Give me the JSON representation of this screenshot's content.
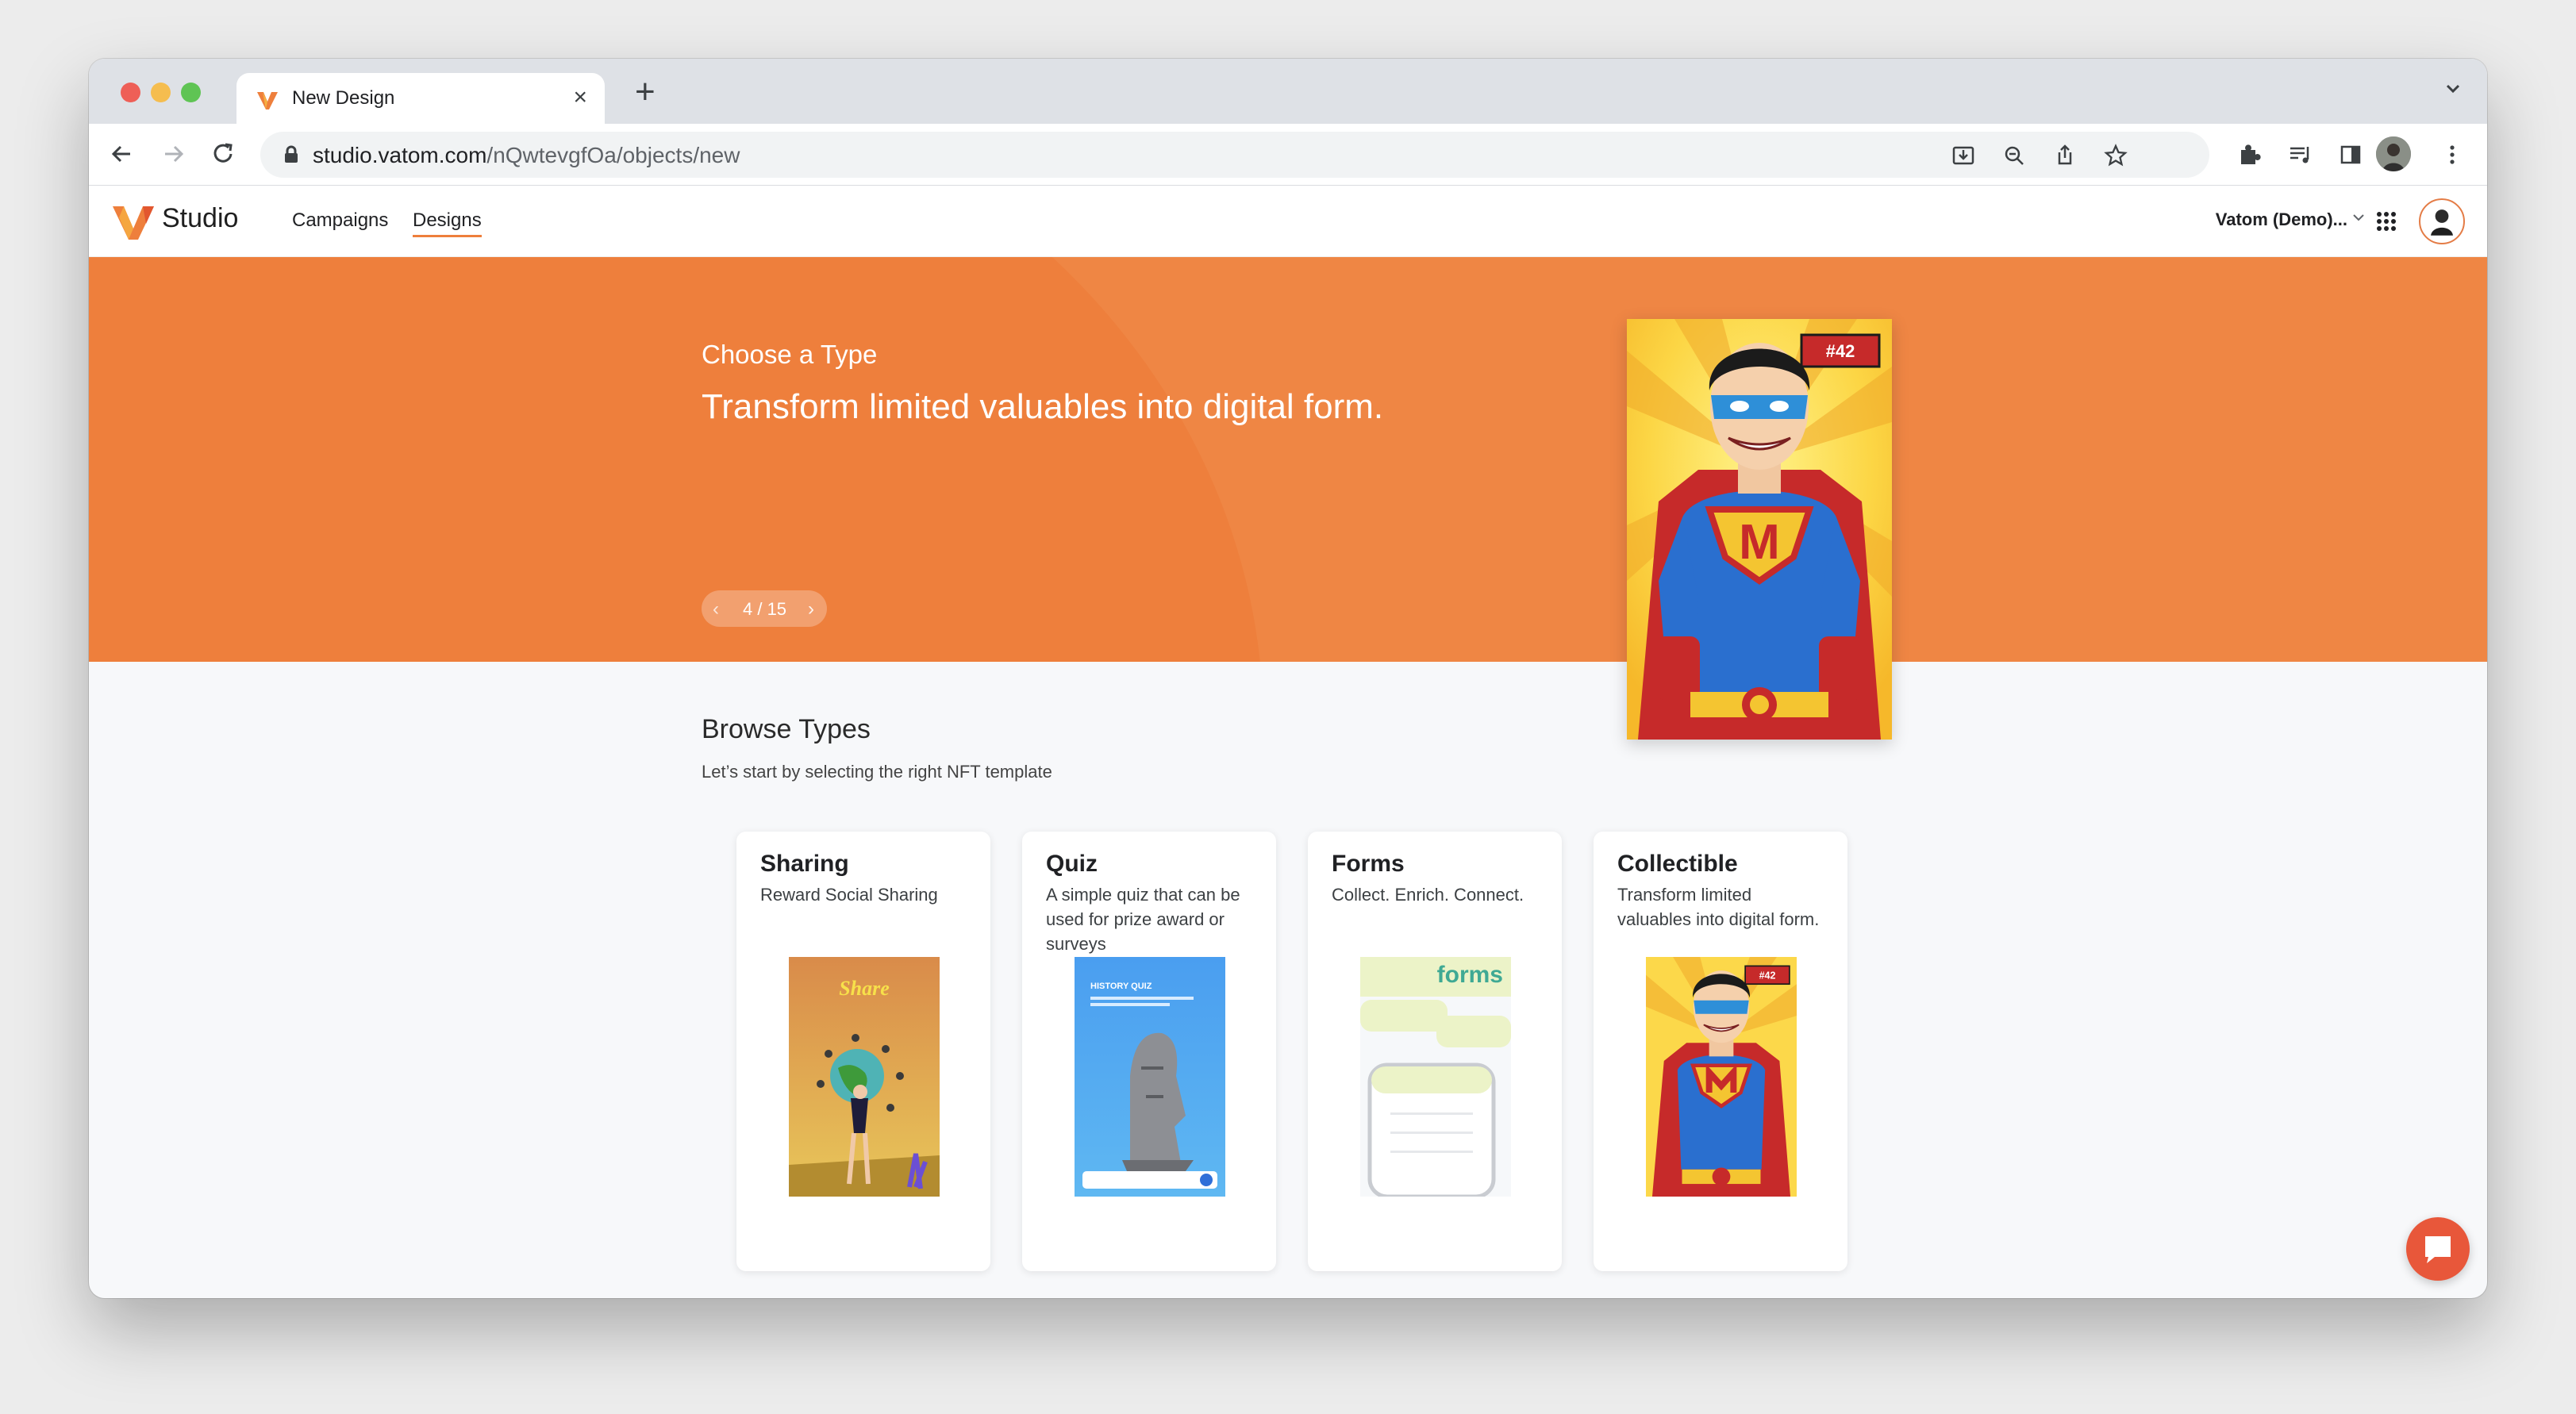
{
  "browser": {
    "tab_title": "New Design",
    "url_host": "studio.vatom.com",
    "url_path": "/nQwtevgfOa/objects/new"
  },
  "app": {
    "brand": "Studio",
    "nav": [
      "Campaigns",
      "Designs"
    ],
    "active_nav": "Designs",
    "org": "Vatom (Demo)..."
  },
  "hero": {
    "subtitle": "Choose a Type",
    "title": "Transform limited valuables into digital form.",
    "pager": "4 / 15",
    "card_badge": "#42",
    "card_emblem": "M"
  },
  "browse": {
    "title": "Browse Types",
    "description": "Let’s start by selecting the right NFT template",
    "cards": [
      {
        "title": "Sharing",
        "description": "Reward Social Sharing",
        "image_text": "Share"
      },
      {
        "title": "Quiz",
        "description": "A simple quiz that can be used for prize award or surveys",
        "image_text": "HISTORY QUIZ"
      },
      {
        "title": "Forms",
        "description": "Collect. Enrich. Connect.",
        "image_text": "forms"
      },
      {
        "title": "Collectible",
        "description": "Transform limited valuables into digital form.",
        "image_text": "#42"
      }
    ]
  },
  "colors": {
    "accent": "#ee7f3c",
    "hero_bg": "#ef8644",
    "chat": "#e8573a"
  },
  "icons": [
    "back-icon",
    "forward-icon",
    "reload-icon",
    "lock-icon",
    "install-icon",
    "zoom-icon",
    "share-icon",
    "star-icon",
    "extensions-icon",
    "media-icon",
    "sidepanel-icon",
    "kebab-menu-icon",
    "apps-grid-icon",
    "chat-icon"
  ]
}
